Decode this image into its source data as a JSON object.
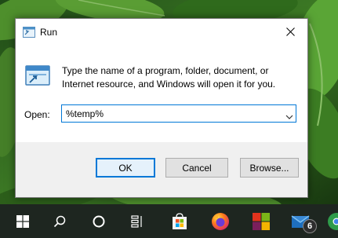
{
  "dialog": {
    "title": "Run",
    "description": "Type the name of a program, folder, document, or Internet resource, and Windows will open it for you.",
    "open_label": "Open:",
    "open_value": "%temp%",
    "buttons": {
      "ok": "OK",
      "cancel": "Cancel",
      "browse": "Browse..."
    }
  },
  "taskbar": {
    "items": [
      {
        "icon": "windows-start-icon"
      },
      {
        "icon": "search-icon"
      },
      {
        "icon": "cortana-icon"
      },
      {
        "icon": "task-view-icon"
      },
      {
        "icon": "microsoft-store-icon"
      },
      {
        "icon": "firefox-icon"
      },
      {
        "icon": "office-icon"
      },
      {
        "icon": "mail-icon"
      }
    ],
    "mail_badge": "6"
  },
  "colors": {
    "accent": "#0078d7",
    "dialog_footer": "#f0f0f0",
    "taskbar": "#1e2620"
  }
}
